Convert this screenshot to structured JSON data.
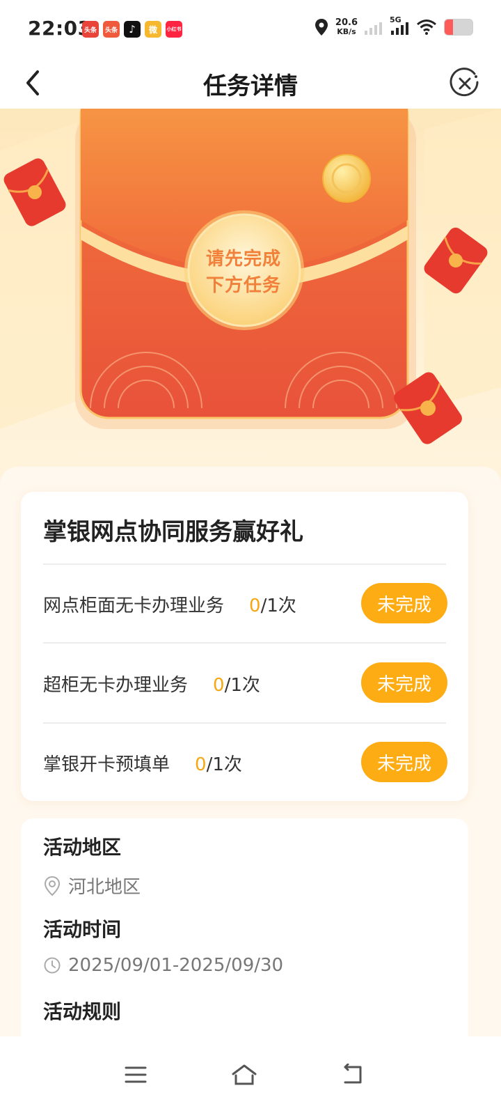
{
  "status_bar": {
    "time": "22:03",
    "app_icons": [
      {
        "icon": "toutiao-icon",
        "label": "头条",
        "color": "#e8443a"
      },
      {
        "icon": "toutiao-lite-icon",
        "label": "头条",
        "color": "#f05a3c"
      },
      {
        "icon": "tiktok-icon",
        "label": "♪",
        "color": "#111111"
      },
      {
        "icon": "weibo-icon",
        "label": "微",
        "color": "#f5b82e"
      },
      {
        "icon": "xiaohongshu-icon",
        "label": "小红书",
        "color": "#ff2442"
      }
    ],
    "net_speed_value": "20.6",
    "net_speed_unit": "KB/s",
    "signal_label": "5G",
    "battery_level": 0.3
  },
  "header": {
    "title": "任务详情",
    "back_icon": "chevron-left-icon",
    "close_icon": "close-circle-icon"
  },
  "banner": {
    "seal_line1": "请先完成",
    "seal_line2": "下方任务"
  },
  "task_card": {
    "title": "掌银网点协同服务赢好礼",
    "tasks": [
      {
        "name": "网点柜面无卡办理业务",
        "done": "0",
        "total": "/1次",
        "status": "未完成"
      },
      {
        "name": "超柜无卡办理业务",
        "done": "0",
        "total": "/1次",
        "status": "未完成"
      },
      {
        "name": "掌银开卡预填单",
        "done": "0",
        "total": "/1次",
        "status": "未完成"
      }
    ]
  },
  "info": {
    "region_heading": "活动地区",
    "region_value": "河北地区",
    "time_heading": "活动时间",
    "time_value": "2025/09/01-2025/09/30",
    "rules_heading": "活动规则"
  },
  "colors": {
    "accent": "#fdac14",
    "progress_highlight": "#f5a814",
    "envelope_red": "#ef5a3c",
    "gold": "#fcd98a"
  },
  "nav": {
    "menu_icon": "menu-icon",
    "home_icon": "home-icon",
    "back_icon": "back-icon"
  }
}
